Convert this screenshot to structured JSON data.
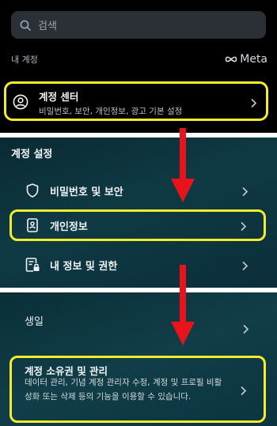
{
  "search": {
    "placeholder": "검색",
    "icon": "search-icon"
  },
  "my_account": {
    "label": "내 계정",
    "brand": "Meta"
  },
  "account_center": {
    "title": "계정 센터",
    "subtitle": "비밀번호, 보안, 개인정보, 광고 기본 설정",
    "icon": "profile-circle-icon"
  },
  "account_settings": {
    "heading": "계정 설정",
    "items": [
      {
        "label": "비밀번호 및 보안",
        "icon": "shield-icon"
      },
      {
        "label": "개인정보",
        "icon": "id-card-icon"
      },
      {
        "label": "내 정보 및 권한",
        "icon": "info-lock-icon"
      }
    ]
  },
  "details": {
    "birthday_label": "생일",
    "ownership": {
      "title": "계정 소유권 및 관리",
      "description": "데이터 관리, 기념 계정 관리자 수정, 계정 및 프로필 비활성화 또는 삭제 등의 기능을 이용할 수 있습니다."
    }
  },
  "colors": {
    "highlight": "#f2ec2c",
    "arrow": "#e8141c",
    "panel_dark": "#000000",
    "panel_teal": "#0f3a44"
  }
}
